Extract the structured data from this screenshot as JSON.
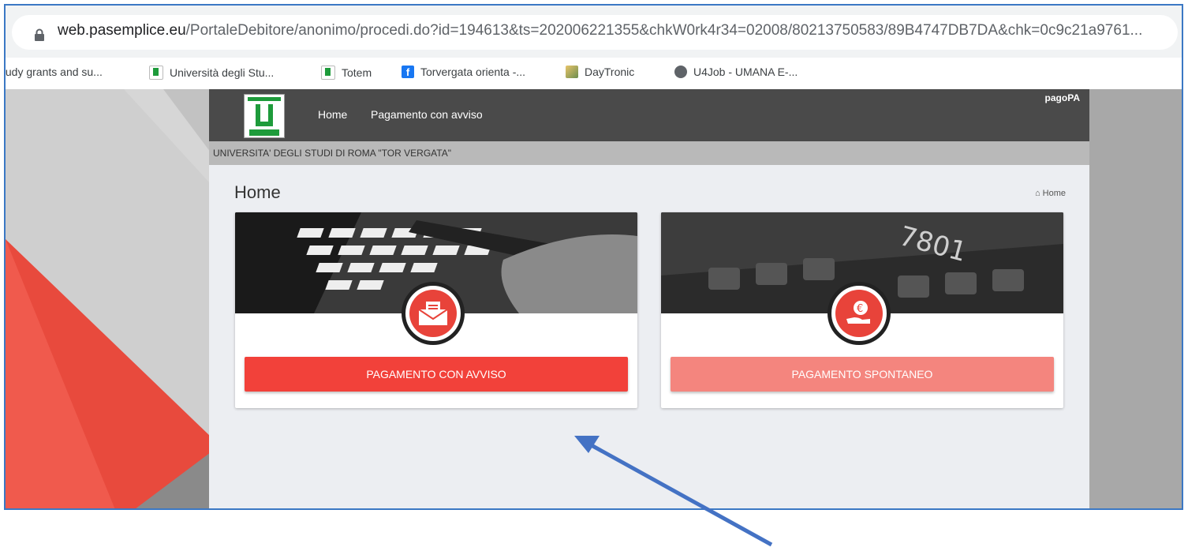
{
  "browser": {
    "url_host": "web.pasemplice.eu",
    "url_path": "/PortaleDebitore/anonimo/procedi.do?id=194613&ts=202006221355&chkW0rk4r34=02008/80213750583/89B4747DB7DA&chk=0c9c21a9761...",
    "bookmarks": [
      {
        "label": "tudy grants and su...",
        "icon": "bookmark-icon"
      },
      {
        "label": "Università degli Stu...",
        "icon": "univ-logo-icon"
      },
      {
        "label": "Totem",
        "icon": "univ-logo-icon"
      },
      {
        "label": "Torvergata orienta -...",
        "icon": "facebook-icon"
      },
      {
        "label": "DayTronic",
        "icon": "daytronic-icon"
      },
      {
        "label": "U4Job - UMANA E-...",
        "icon": "globe-icon"
      }
    ]
  },
  "site": {
    "nav": {
      "home": "Home",
      "pagamento": "Pagamento con avviso",
      "pagopa": "pagoPA"
    },
    "org_name": "UNIVERSITA' DEGLI STUDI DI ROMA \"TOR VERGATA\"",
    "page_title": "Home",
    "breadcrumb": "Home",
    "cards": [
      {
        "button": "PAGAMENTO CON AVVISO",
        "icon": "envelope-receipt-icon",
        "color": "#f2413a"
      },
      {
        "button": "PAGAMENTO SPONTANEO",
        "icon": "hand-euro-icon",
        "color": "#f4857e"
      }
    ]
  },
  "colors": {
    "accent": "#f2413a",
    "annotation_arrow": "#4472c4"
  }
}
